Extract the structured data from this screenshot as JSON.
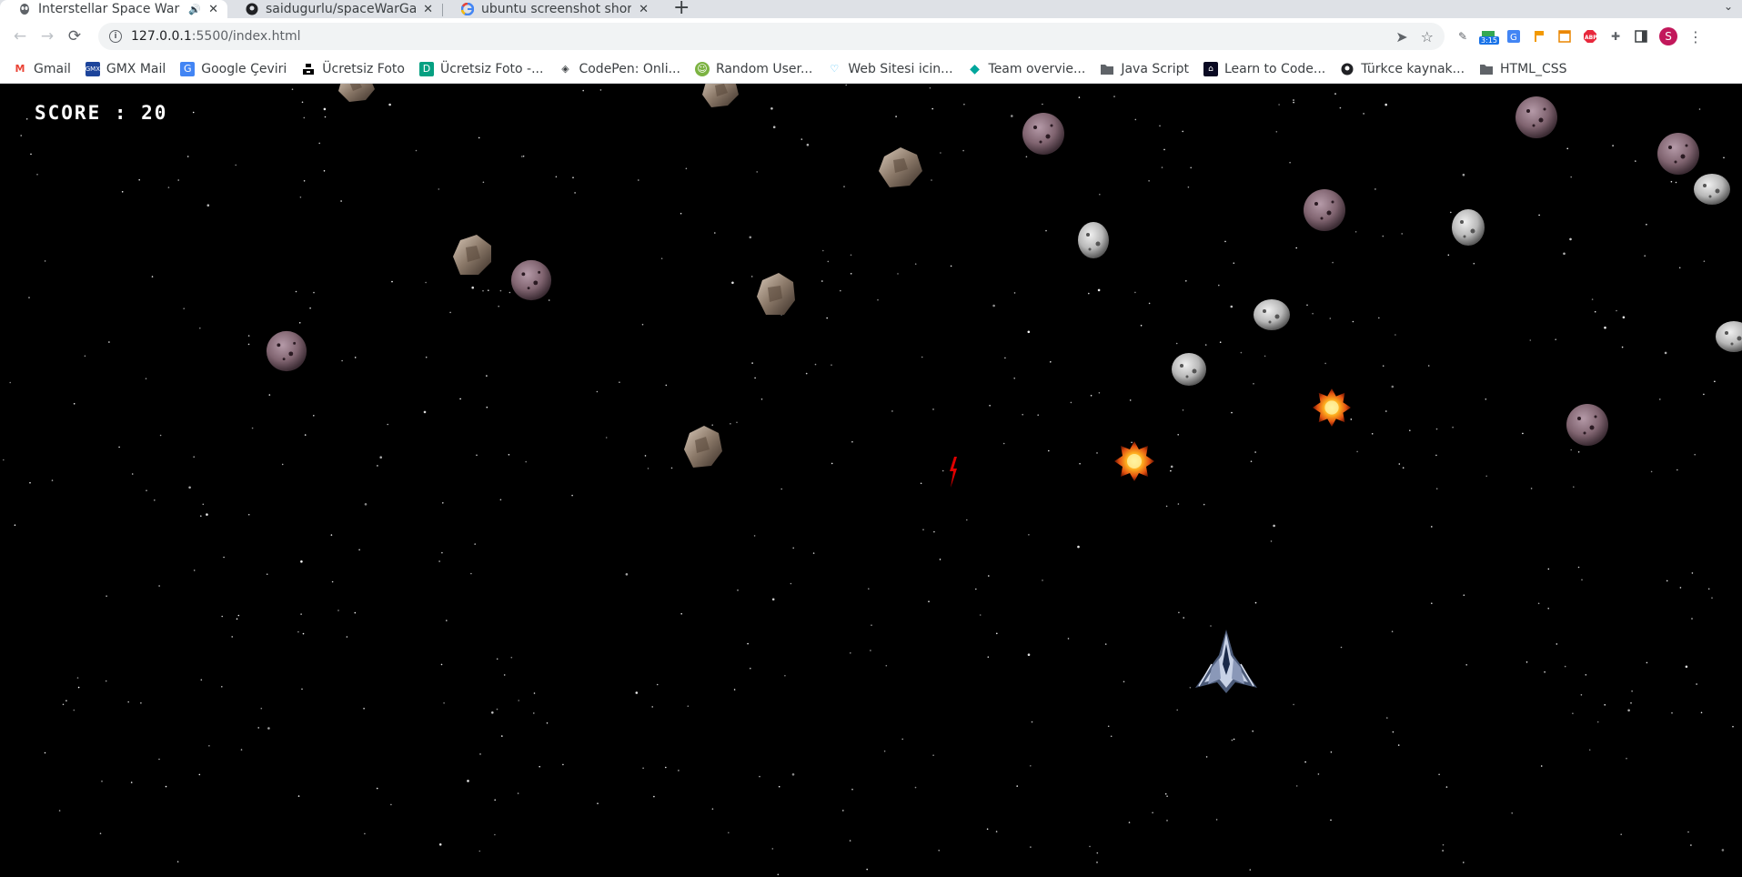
{
  "browser": {
    "tabs": [
      {
        "title": "Interstellar Space War",
        "icon": "alien-icon",
        "active": true,
        "audio": true
      },
      {
        "title": "saidugurlu/spaceWarGam",
        "icon": "github-icon",
        "active": false
      },
      {
        "title": "ubuntu screenshot shortc",
        "icon": "google-icon",
        "active": false
      }
    ],
    "address": {
      "host": "127.0.0.1",
      "path": ":5500/index.html"
    },
    "extension_badge": "3:15",
    "profile_initial": "S"
  },
  "bookmarks": [
    {
      "label": "Gmail",
      "icon": "gmail-icon"
    },
    {
      "label": "GMX Mail",
      "icon": "gmx-icon"
    },
    {
      "label": "Google Çeviri",
      "icon": "translate-icon"
    },
    {
      "label": "Ücretsiz Foto",
      "icon": "unsplash-icon"
    },
    {
      "label": "Ücretsiz Foto -...",
      "icon": "photo-icon"
    },
    {
      "label": "CodePen: Onli...",
      "icon": "codepen-icon"
    },
    {
      "label": "Random User...",
      "icon": "randomuser-icon"
    },
    {
      "label": "Web Sitesi icin...",
      "icon": "heart-icon"
    },
    {
      "label": "Team overvie...",
      "icon": "diamond-icon"
    },
    {
      "label": "Java Script",
      "icon": "folder-icon"
    },
    {
      "label": "Learn to Code...",
      "icon": "fcc-icon"
    },
    {
      "label": "Türkce kaynak...",
      "icon": "github-icon"
    },
    {
      "label": "HTML_CSS",
      "icon": "folder-icon"
    }
  ],
  "game": {
    "score_text": "SCORE : 20",
    "sprites": {
      "asteroids": [
        "rock-asteroid",
        "grey-asteroid",
        "purple-asteroid"
      ],
      "explosions": 2,
      "player": "spaceship",
      "bullet": "red-laser"
    }
  }
}
